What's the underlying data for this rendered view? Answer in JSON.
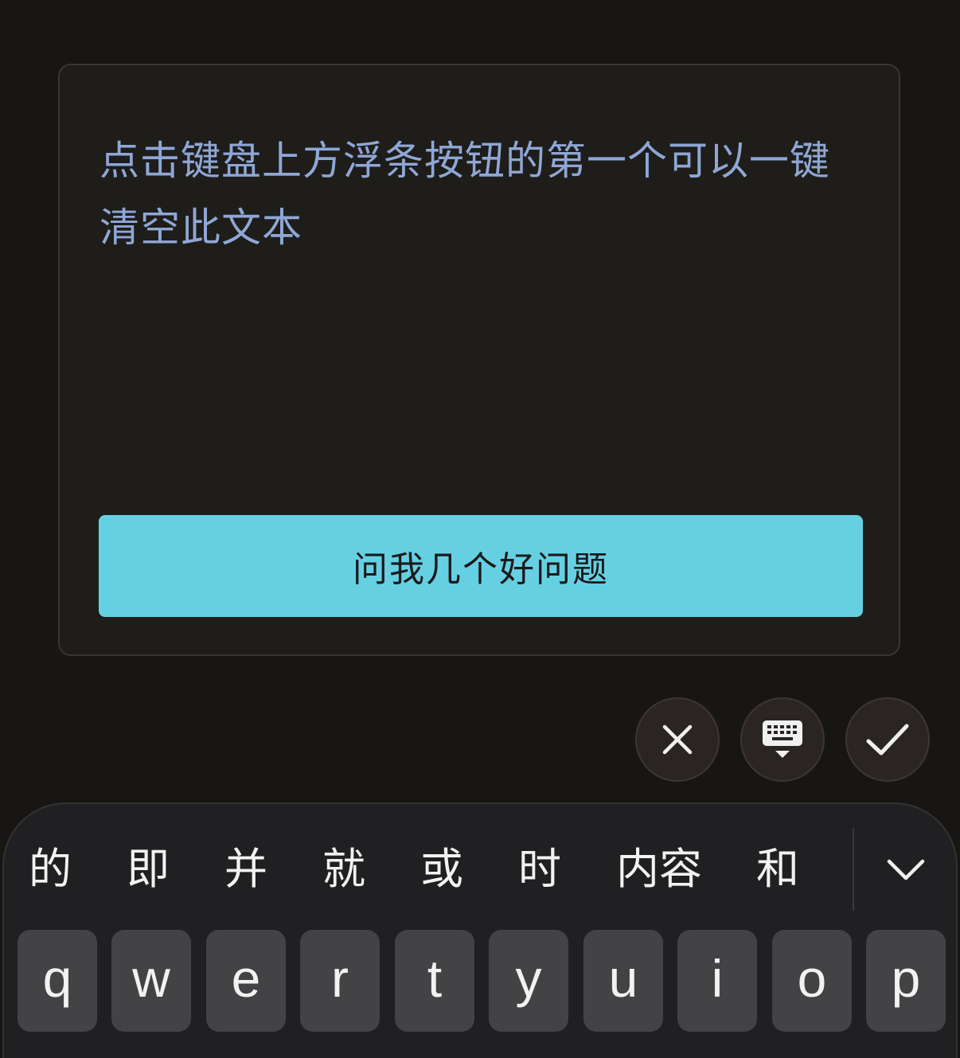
{
  "note": {
    "text": "点击键盘上方浮条按钮的第一个可以一键清空此文本"
  },
  "ask_button": {
    "label": "问我几个好问题"
  },
  "toolbar": {
    "clear_icon": "close-icon",
    "hide_keyboard_icon": "keyboard-hide-icon",
    "done_icon": "check-icon"
  },
  "keyboard": {
    "candidates": [
      "的",
      "即",
      "并",
      "就",
      "或",
      "时",
      "内容",
      "和"
    ],
    "expand_icon": "chevron-down-icon",
    "keys": [
      "q",
      "w",
      "e",
      "r",
      "t",
      "y",
      "u",
      "i",
      "o",
      "p"
    ]
  },
  "colors": {
    "background": "#181614",
    "card": "#1e1d1a",
    "note_text": "#8fa7d6",
    "button": "#66d0e3",
    "key": "#434244"
  }
}
